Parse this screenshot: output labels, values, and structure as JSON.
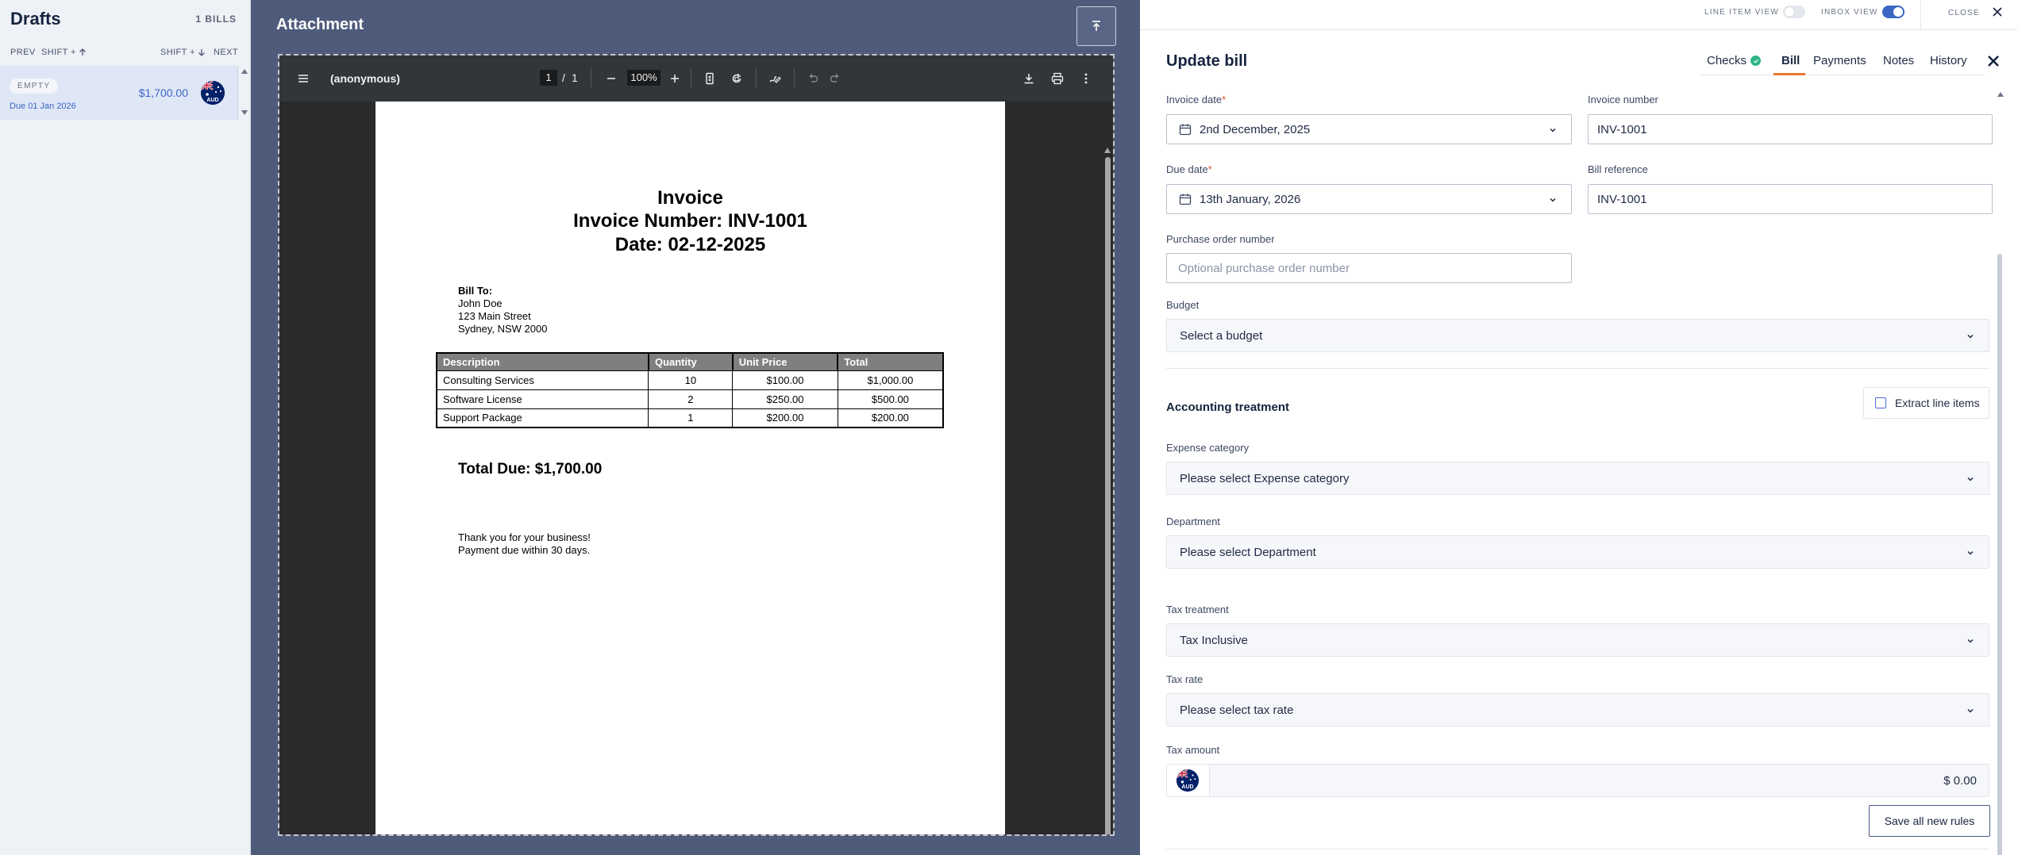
{
  "drafts": {
    "title": "Drafts",
    "count_label": "1 BILLS",
    "nav": {
      "prev": "PREV",
      "prev_shortcut": "SHIFT +",
      "next_shortcut": "SHIFT +",
      "next": "NEXT"
    },
    "items": [
      {
        "status": "EMPTY",
        "due": "Due 01 Jan 2026",
        "amount": "$1,700.00",
        "currency": "AUD"
      }
    ]
  },
  "attachment": {
    "title": "Attachment",
    "upload_icon": "upload-icon",
    "viewer": {
      "doc_name": "(anonymous)",
      "page_current": "1",
      "page_sep": "/",
      "page_total": "1",
      "zoom": "100%"
    },
    "invoice": {
      "title": "Invoice",
      "number_line": "Invoice Number: INV-1001",
      "date_line": "Date: 02-12-2025",
      "bill_to_label": "Bill To:",
      "bill_to_name": "John Doe",
      "bill_to_street": "123 Main Street",
      "bill_to_city": "Sydney, NSW 2000",
      "columns": [
        "Description",
        "Quantity",
        "Unit Price",
        "Total"
      ],
      "rows": [
        [
          "Consulting Services",
          "10",
          "$100.00",
          "$1,000.00"
        ],
        [
          "Software License",
          "2",
          "$250.00",
          "$500.00"
        ],
        [
          "Support Package",
          "1",
          "$200.00",
          "$200.00"
        ]
      ],
      "total_due": "Total Due: $1,700.00",
      "thanks": "Thank you for your business!",
      "terms": "Payment due within 30 days."
    }
  },
  "topbar": {
    "line_item_view": "LINE ITEM VIEW",
    "line_item_view_on": false,
    "inbox_view": "INBOX VIEW",
    "inbox_view_on": true,
    "close": "CLOSE"
  },
  "form": {
    "title": "Update bill",
    "tabs": [
      {
        "label": "Checks",
        "active": false
      },
      {
        "label": "Bill",
        "active": true
      },
      {
        "label": "Payments",
        "active": false
      },
      {
        "label": "Notes",
        "active": false
      },
      {
        "label": "History",
        "active": false
      }
    ],
    "invoice_date_label": "Invoice date",
    "invoice_date": "2nd December, 2025",
    "invoice_number_label": "Invoice number",
    "invoice_number": "INV-1001",
    "due_date_label": "Due date",
    "due_date": "13th January, 2026",
    "bill_reference_label": "Bill reference",
    "bill_reference": "INV-1001",
    "po_label": "Purchase order number",
    "po_placeholder": "Optional purchase order number",
    "budget_label": "Budget",
    "budget_value": "Select a budget",
    "accounting_heading": "Accounting treatment",
    "extract_label": "Extract line items",
    "extract_checked": false,
    "expense_label": "Expense category",
    "expense_value": "Please select Expense category",
    "department_label": "Department",
    "department_value": "Please select Department",
    "tax_treatment_label": "Tax treatment",
    "tax_treatment_value": "Tax Inclusive",
    "tax_rate_label": "Tax rate",
    "tax_rate_value": "Please select tax rate",
    "tax_amount_label": "Tax amount",
    "tax_amount_currency": "AUD",
    "tax_amount_value": "$ 0.00",
    "save_rules": "Save all new rules",
    "required_mark": "*"
  },
  "colors": {
    "attachment_bg": "#4f5b7b",
    "accent_orange": "#e97830",
    "link_blue": "#3b66c4",
    "toggle_on": "#3b66c4",
    "check_green": "#2fb58a"
  }
}
